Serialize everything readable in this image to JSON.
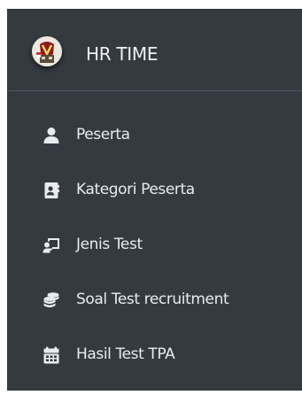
{
  "brand": {
    "title": "HR TIME",
    "logo_icon": "hr-time-logo-icon"
  },
  "sidebar": {
    "items": [
      {
        "label": "Peserta",
        "icon": "user-icon"
      },
      {
        "label": "Kategori Peserta",
        "icon": "address-card-icon"
      },
      {
        "label": "Jenis Test",
        "icon": "chalkboard-teacher-icon"
      },
      {
        "label": "Soal Test recruitment",
        "icon": "coins-icon"
      },
      {
        "label": "Hasil Test TPA",
        "icon": "calendar-icon"
      }
    ]
  },
  "colors": {
    "sidebar_bg": "#343a40",
    "text": "#e9ecef",
    "icon": "#c2c7d0"
  }
}
